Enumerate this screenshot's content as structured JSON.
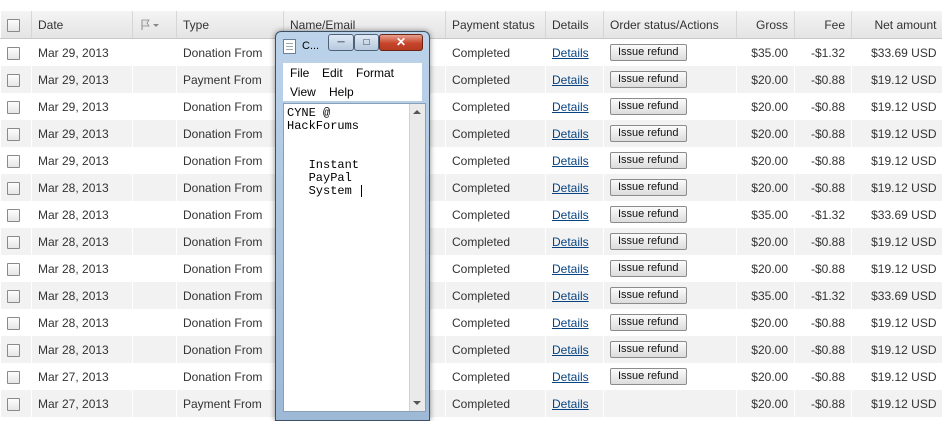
{
  "columns": {
    "date": "Date",
    "type": "Type",
    "name": "Name/Email",
    "payment_status": "Payment status",
    "details": "Details",
    "order_status": "Order status/Actions",
    "gross": "Gross",
    "fee": "Fee",
    "net": "Net amount"
  },
  "rows": [
    {
      "date": "Mar 29, 2013",
      "type": "Donation From",
      "status": "Completed",
      "details": "Details",
      "action": "Issue refund",
      "gross": "$35.00",
      "fee": "-$1.32",
      "net": "$33.69 USD"
    },
    {
      "date": "Mar 29, 2013",
      "type": "Payment From",
      "status": "Completed",
      "details": "Details",
      "action": "Issue refund",
      "gross": "$20.00",
      "fee": "-$0.88",
      "net": "$19.12 USD"
    },
    {
      "date": "Mar 29, 2013",
      "type": "Donation From",
      "status": "Completed",
      "details": "Details",
      "action": "Issue refund",
      "gross": "$20.00",
      "fee": "-$0.88",
      "net": "$19.12 USD"
    },
    {
      "date": "Mar 29, 2013",
      "type": "Donation From",
      "status": "Completed",
      "details": "Details",
      "action": "Issue refund",
      "gross": "$20.00",
      "fee": "-$0.88",
      "net": "$19.12 USD"
    },
    {
      "date": "Mar 29, 2013",
      "type": "Donation From",
      "status": "Completed",
      "details": "Details",
      "action": "Issue refund",
      "gross": "$20.00",
      "fee": "-$0.88",
      "net": "$19.12 USD"
    },
    {
      "date": "Mar 28, 2013",
      "type": "Donation From",
      "status": "Completed",
      "details": "Details",
      "action": "Issue refund",
      "gross": "$20.00",
      "fee": "-$0.88",
      "net": "$19.12 USD"
    },
    {
      "date": "Mar 28, 2013",
      "type": "Donation From",
      "status": "Completed",
      "details": "Details",
      "action": "Issue refund",
      "gross": "$35.00",
      "fee": "-$1.32",
      "net": "$33.69 USD"
    },
    {
      "date": "Mar 28, 2013",
      "type": "Donation From",
      "status": "Completed",
      "details": "Details",
      "action": "Issue refund",
      "gross": "$20.00",
      "fee": "-$0.88",
      "net": "$19.12 USD"
    },
    {
      "date": "Mar 28, 2013",
      "type": "Donation From",
      "status": "Completed",
      "details": "Details",
      "action": "Issue refund",
      "gross": "$20.00",
      "fee": "-$0.88",
      "net": "$19.12 USD"
    },
    {
      "date": "Mar 28, 2013",
      "type": "Donation From",
      "status": "Completed",
      "details": "Details",
      "action": "Issue refund",
      "gross": "$35.00",
      "fee": "-$1.32",
      "net": "$33.69 USD"
    },
    {
      "date": "Mar 28, 2013",
      "type": "Donation From",
      "status": "Completed",
      "details": "Details",
      "action": "Issue refund",
      "gross": "$20.00",
      "fee": "-$0.88",
      "net": "$19.12 USD"
    },
    {
      "date": "Mar 28, 2013",
      "type": "Donation From",
      "status": "Completed",
      "details": "Details",
      "action": "Issue refund",
      "gross": "$20.00",
      "fee": "-$0.88",
      "net": "$19.12 USD"
    },
    {
      "date": "Mar 27, 2013",
      "type": "Donation From",
      "status": "Completed",
      "details": "Details",
      "action": "Issue refund",
      "gross": "$20.00",
      "fee": "-$0.88",
      "net": "$19.12 USD"
    },
    {
      "date": "Mar 27, 2013",
      "type": "Payment From",
      "status": "Completed",
      "details": "Details",
      "action": "",
      "gross": "$20.00",
      "fee": "-$0.88",
      "net": "$19.12 USD"
    }
  ],
  "notepad": {
    "title_short": "C...",
    "menu": [
      "File",
      "Edit",
      "Format",
      "View",
      "Help"
    ],
    "text": "CYNE @\nHackForums\n\n\n   Instant\n   PayPal\n   System "
  },
  "icons": [
    "checkbox-icon",
    "flag-icon",
    "notepad-icon",
    "minimize-icon",
    "maximize-icon",
    "close-icon"
  ]
}
